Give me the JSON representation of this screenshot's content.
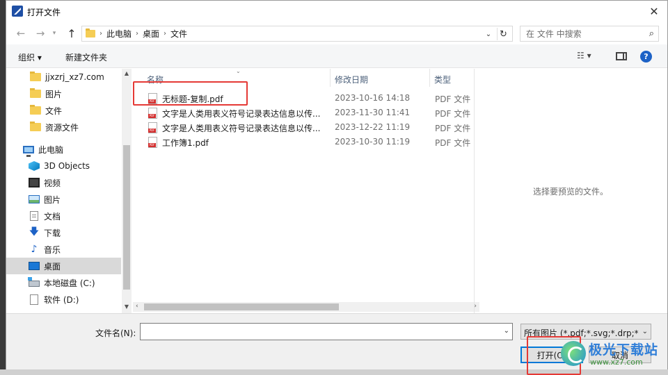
{
  "window": {
    "title": "打开文件",
    "close_glyph": "✕"
  },
  "nav": {
    "back_glyph": "←",
    "forward_glyph": "→",
    "history_glyph": "▾",
    "up_glyph": "↑",
    "breadcrumbs": [
      "此电脑",
      "桌面",
      "文件"
    ],
    "crumb_sep": "›",
    "addr_drop_glyph": "⌄",
    "refresh_glyph": "↻",
    "search_placeholder": "在 文件 中搜索",
    "search_glyph": "⌕"
  },
  "toolbar": {
    "organize_label": "组织 ▾",
    "new_folder_label": "新建文件夹",
    "view_label": "☷ ▾",
    "help_glyph": "?"
  },
  "sidebar": {
    "items": [
      {
        "label": "jjxzrj_xz7.com",
        "icon": "folder-icon"
      },
      {
        "label": "图片",
        "icon": "folder-icon"
      },
      {
        "label": "文件",
        "icon": "folder-icon"
      },
      {
        "label": "资源文件",
        "icon": "folder-icon"
      },
      {
        "label": "此电脑",
        "icon": "computer-icon"
      },
      {
        "label": "3D Objects",
        "icon": "3d-objects-icon"
      },
      {
        "label": "视频",
        "icon": "video-icon"
      },
      {
        "label": "图片",
        "icon": "pictures-icon"
      },
      {
        "label": "文档",
        "icon": "documents-icon"
      },
      {
        "label": "下载",
        "icon": "download-icon"
      },
      {
        "label": "音乐",
        "icon": "music-icon"
      },
      {
        "label": "桌面",
        "icon": "desktop-icon",
        "selected": true
      },
      {
        "label": "本地磁盘 (C:)",
        "icon": "drive-icon"
      },
      {
        "label": "软件 (D:)",
        "icon": "disk-icon"
      }
    ],
    "download_glyph": "🡇",
    "music_glyph": "♪",
    "scroll_up_glyph": "▲",
    "scroll_down_glyph": "▼"
  },
  "filelist": {
    "columns": [
      "名称",
      "修改日期",
      "类型"
    ],
    "sort_glyph": "⌄",
    "rows": [
      {
        "name": "无标题-复制.pdf",
        "date": "2023-10-16 14:18",
        "type": "PDF 文件"
      },
      {
        "name": "文字是人类用表义符号记录表达信息以传...",
        "date": "2023-11-30 11:41",
        "type": "PDF 文件"
      },
      {
        "name": "文字是人类用表义符号记录表达信息以传...",
        "date": "2023-12-22 11:19",
        "type": "PDF 文件"
      },
      {
        "name": "工作簿1.pdf",
        "date": "2023-10-30 11:19",
        "type": "PDF 文件"
      }
    ],
    "hscroll_left_glyph": "‹",
    "hscroll_right_glyph": "›"
  },
  "preview": {
    "empty_text": "选择要预览的文件。"
  },
  "bottom": {
    "filename_label": "文件名(N):",
    "filename_value": "",
    "filter_value": "所有图片 (*.pdf;*.svg;*.drp;*.b",
    "open_label": "打开(O)",
    "cancel_label": "取消",
    "drop_glyph": "⌄"
  },
  "watermark": {
    "name": "极光下载站",
    "url": "www.xz7.com"
  },
  "colors": {
    "accent": "#0078d7",
    "highlight_red": "#e53935",
    "folder": "#f5cd55"
  }
}
